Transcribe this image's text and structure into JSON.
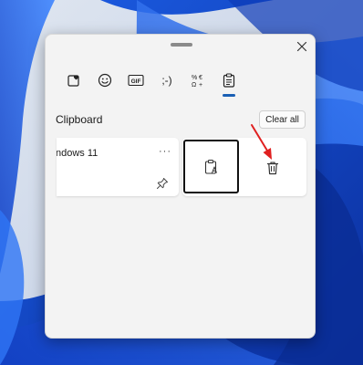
{
  "panel": {
    "tabs": [
      {
        "icon": "kaomoji-heart-icon"
      },
      {
        "icon": "emoji-icon"
      },
      {
        "icon": "gif-icon",
        "label": "GIF"
      },
      {
        "icon": "kaomoji-icon",
        "label": ";-)"
      },
      {
        "icon": "symbols-icon"
      },
      {
        "icon": "clipboard-icon",
        "active": true
      }
    ],
    "close_icon": "close-icon"
  },
  "clipboard": {
    "title": "Clipboard",
    "clear_all_label": "Clear all",
    "items": [
      {
        "text": "ndows 11",
        "more_label": "···",
        "pin_icon": "pin-icon"
      }
    ],
    "actions": {
      "paste_icon": "paste-as-text-icon",
      "delete_icon": "delete-icon"
    }
  },
  "colors": {
    "accent": "#1a5fb4",
    "annotation_arrow": "#e02020",
    "wallpaper": "#1f5fd8"
  }
}
